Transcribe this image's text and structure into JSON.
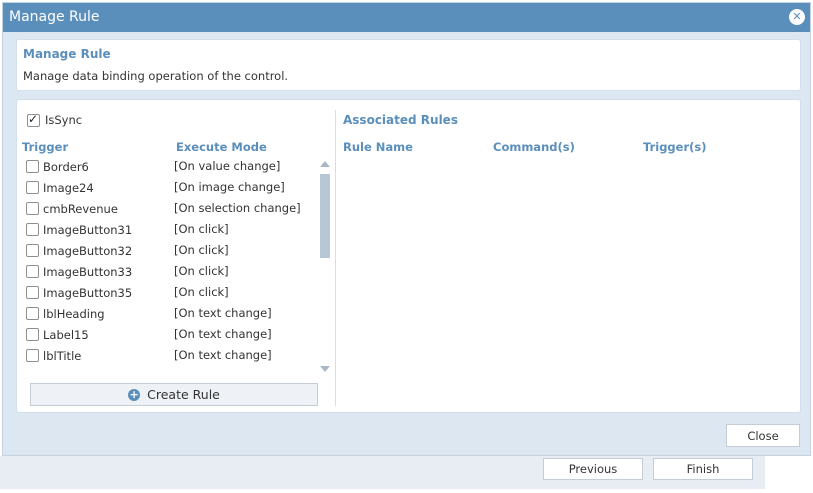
{
  "dialog": {
    "title": "Manage Rule"
  },
  "header": {
    "title": "Manage Rule",
    "description": "Manage data binding operation of the control."
  },
  "issync": {
    "label": "IsSync",
    "checked": true
  },
  "triggers": {
    "col_trigger": "Trigger",
    "col_mode": "Execute Mode",
    "items": [
      {
        "name": "Border6",
        "mode": "[On value change]"
      },
      {
        "name": "Image24",
        "mode": "[On image change]"
      },
      {
        "name": "cmbRevenue",
        "mode": "[On selection change]"
      },
      {
        "name": "ImageButton31",
        "mode": "[On click]"
      },
      {
        "name": "ImageButton32",
        "mode": "[On click]"
      },
      {
        "name": "ImageButton33",
        "mode": "[On click]"
      },
      {
        "name": "ImageButton35",
        "mode": "[On click]"
      },
      {
        "name": "lblHeading",
        "mode": "[On text change]"
      },
      {
        "name": "Label15",
        "mode": "[On text change]"
      },
      {
        "name": "lblTitle",
        "mode": "[On text change]"
      }
    ]
  },
  "create_rule": {
    "label": "Create Rule"
  },
  "associated": {
    "title": "Associated Rules",
    "col_rule_name": "Rule Name",
    "col_commands": "Command(s)",
    "col_triggers": "Trigger(s)"
  },
  "buttons": {
    "close": "Close",
    "previous": "Previous",
    "finish": "Finish"
  }
}
